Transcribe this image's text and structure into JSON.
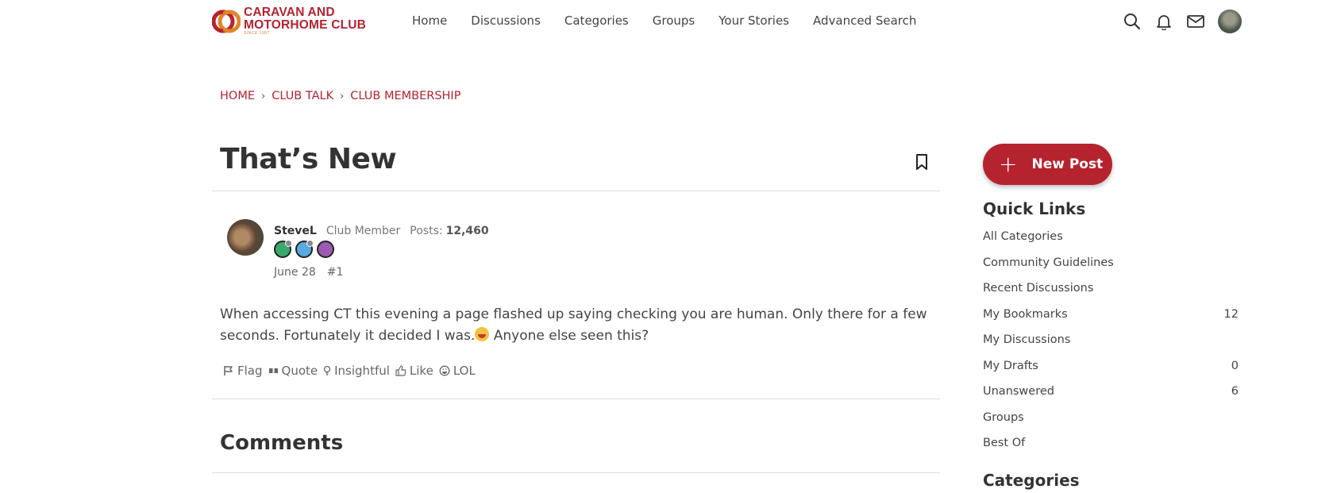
{
  "brand": {
    "line1": "CARAVAN AND",
    "line2": "MOTORHOME CLUB",
    "since": "SINCE 1907",
    "color": "#b5232f"
  },
  "nav": [
    "Home",
    "Discussions",
    "Categories",
    "Groups",
    "Your Stories",
    "Advanced Search"
  ],
  "header_icons": [
    "search-icon",
    "bell-icon",
    "mail-icon",
    "user-avatar"
  ],
  "breadcrumb": [
    "HOME",
    "CLUB TALK",
    "CLUB MEMBERSHIP"
  ],
  "discussion": {
    "title": "That’s New",
    "author": {
      "name": "SteveL",
      "role": "Club Member",
      "posts_label": "Posts:",
      "posts": "12,460"
    },
    "date": "June 28",
    "post_number": "#1",
    "body_part1": "When accessing CT this evening a page flashed up saying checking you are human. Only there for a few seconds. Fortunately it decided I was.",
    "body_part2": " Anyone else seen this?",
    "actions": [
      "Flag",
      "Quote",
      "Insightful",
      "Like",
      "LOL"
    ]
  },
  "comments_heading": "Comments",
  "sidebar": {
    "new_post": "New Post",
    "quick_links_title": "Quick Links",
    "quick_links": [
      {
        "label": "All Categories",
        "count": ""
      },
      {
        "label": "Community Guidelines",
        "count": ""
      },
      {
        "label": "Recent Discussions",
        "count": ""
      },
      {
        "label": "My Bookmarks",
        "count": "12"
      },
      {
        "label": "My Discussions",
        "count": ""
      },
      {
        "label": "My Drafts",
        "count": "0"
      },
      {
        "label": "Unanswered",
        "count": "6"
      },
      {
        "label": "Groups",
        "count": ""
      },
      {
        "label": "Best Of",
        "count": ""
      }
    ],
    "categories_title": "Categories"
  }
}
